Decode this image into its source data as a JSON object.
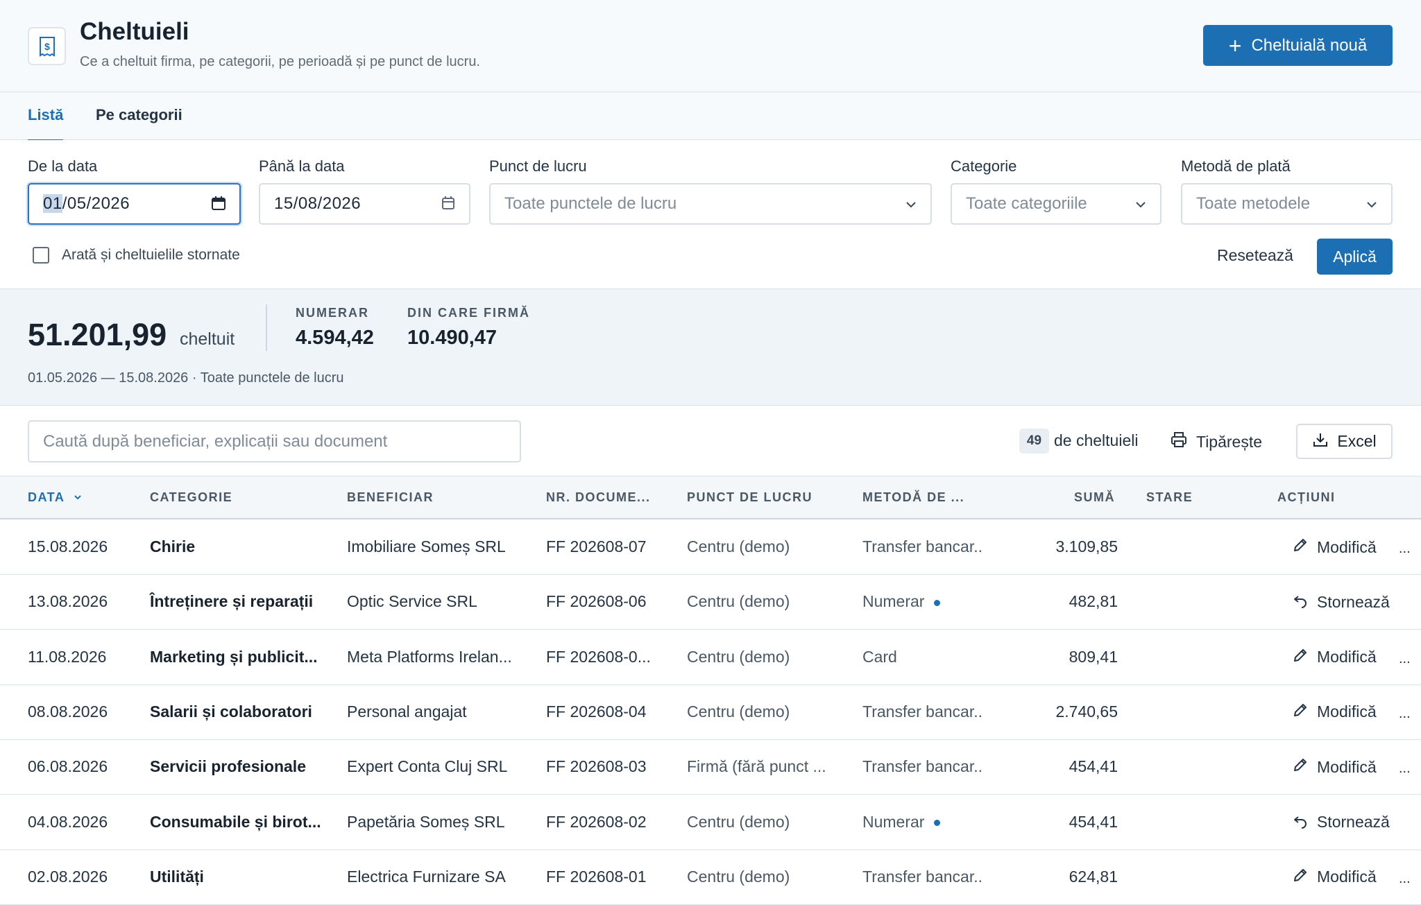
{
  "header": {
    "title": "Cheltuieli",
    "subtitle": "Ce a cheltuit firma, pe categorii, pe perioadă și pe punct de lucru.",
    "new_button": "Cheltuială nouă",
    "logo_icon": "receipt-dollar-icon"
  },
  "tabs": [
    {
      "label": "Listă",
      "active": true
    },
    {
      "label": "Pe categorii",
      "active": false
    }
  ],
  "filters": {
    "from_label": "De la data",
    "from_value_day": "01",
    "from_value_rest": "/05/2026",
    "to_label": "Până la data",
    "to_value": "15/08/2026",
    "location_label": "Punct de lucru",
    "location_placeholder": "Toate punctele de lucru",
    "category_label": "Categorie",
    "category_placeholder": "Toate categoriile",
    "method_label": "Metodă de plată",
    "method_placeholder": "Toate metodele",
    "show_reversed_label": "Arată și cheltuielile stornate",
    "show_reversed_checked": false,
    "reset_label": "Resetează",
    "apply_label": "Aplică"
  },
  "summary": {
    "total": "51.201,99",
    "total_suffix": "cheltuit",
    "cash_label": "NUMERAR",
    "cash_value": "4.594,42",
    "company_label": "DIN CARE FIRMĂ",
    "company_value": "10.490,47",
    "range_text": "01.05.2026 — 15.08.2026 · Toate punctele de lucru"
  },
  "toolbar": {
    "search_placeholder": "Caută după beneficiar, explicații sau document",
    "count": "49",
    "count_label": "de cheltuieli",
    "print_label": "Tipărește",
    "excel_label": "Excel"
  },
  "columns": {
    "date": "DATA",
    "category": "CATEGORIE",
    "beneficiary": "BENEFICIAR",
    "document": "NR. DOCUME...",
    "location": "PUNCT DE LUCRU",
    "method": "METODĂ DE ...",
    "amount": "SUMĂ",
    "status": "STARE",
    "actions": "ACȚIUNI"
  },
  "rows": [
    {
      "date": "15.08.2026",
      "category": "Chirie",
      "beneficiary": "Imobiliare Someș SRL",
      "document": "FF 202608-07",
      "location": "Centru (demo)",
      "method": "Transfer bancar..",
      "amount": "3.109,85",
      "action": "Modifică",
      "cash": false
    },
    {
      "date": "13.08.2026",
      "category": "Întreținere și reparații",
      "beneficiary": "Optic Service SRL",
      "document": "FF 202608-06",
      "location": "Centru (demo)",
      "method": "Numerar",
      "amount": "482,81",
      "action": "Stornează",
      "cash": true
    },
    {
      "date": "11.08.2026",
      "category": "Marketing și publicit...",
      "beneficiary": "Meta Platforms Irelan...",
      "document": "FF 202608-0...",
      "location": "Centru (demo)",
      "method": "Card",
      "amount": "809,41",
      "action": "Modifică",
      "cash": false
    },
    {
      "date": "08.08.2026",
      "category": "Salarii și colaboratori",
      "beneficiary": "Personal angajat",
      "document": "FF 202608-04",
      "location": "Centru (demo)",
      "method": "Transfer bancar..",
      "amount": "2.740,65",
      "action": "Modifică",
      "cash": false
    },
    {
      "date": "06.08.2026",
      "category": "Servicii profesionale",
      "beneficiary": "Expert Conta Cluj SRL",
      "document": "FF 202608-03",
      "location": "Firmă (fără punct ...",
      "method": "Transfer bancar..",
      "amount": "454,41",
      "action": "Modifică",
      "cash": false
    },
    {
      "date": "04.08.2026",
      "category": "Consumabile și birot...",
      "beneficiary": "Papetăria Someș SRL",
      "document": "FF 202608-02",
      "location": "Centru (demo)",
      "method": "Numerar",
      "amount": "454,41",
      "action": "Stornează",
      "cash": true
    },
    {
      "date": "02.08.2026",
      "category": "Utilități",
      "beneficiary": "Electrica Furnizare SA",
      "document": "FF 202608-01",
      "location": "Centru (demo)",
      "method": "Transfer bancar..",
      "amount": "624,81",
      "action": "Modifică",
      "cash": false
    }
  ],
  "more_label": "...",
  "colors": {
    "accent": "#1d6fb3",
    "header_bg": "#f7fafc",
    "summary_bg": "#eff4f8"
  }
}
